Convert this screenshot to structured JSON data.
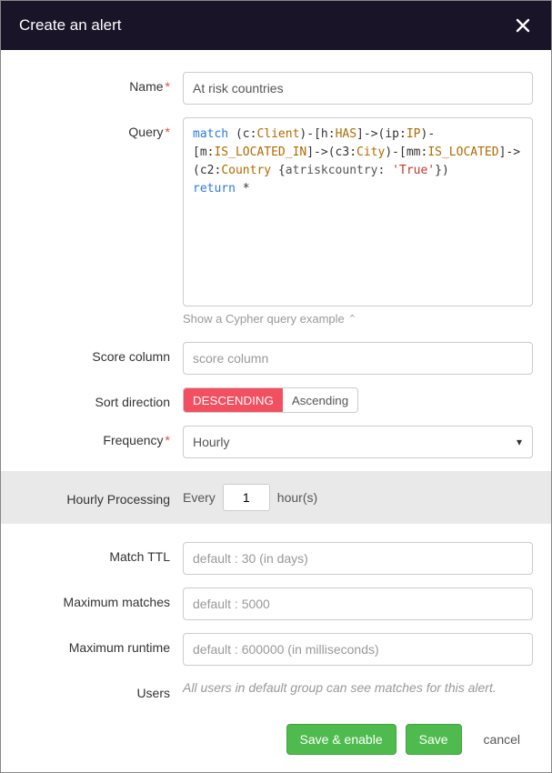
{
  "header": {
    "title": "Create an alert"
  },
  "labels": {
    "name": "Name",
    "query": "Query",
    "score_column": "Score column",
    "sort_direction": "Sort direction",
    "frequency": "Frequency",
    "hourly_processing": "Hourly Processing",
    "match_ttl": "Match TTL",
    "max_matches": "Maximum matches",
    "max_runtime": "Maximum runtime",
    "users": "Users"
  },
  "fields": {
    "name_value": "At risk countries",
    "query_tokens": [
      {
        "t": "match ",
        "c": "kw"
      },
      {
        "t": "(c:",
        "c": "rel"
      },
      {
        "t": "Client",
        "c": "lbl"
      },
      {
        "t": ")-[h:",
        "c": "rel"
      },
      {
        "t": "HAS",
        "c": "lbl"
      },
      {
        "t": "]->(ip:",
        "c": "rel"
      },
      {
        "t": "IP",
        "c": "lbl"
      },
      {
        "t": ")-[m:",
        "c": "rel"
      },
      {
        "t": "IS_LOCATED_IN",
        "c": "lbl"
      },
      {
        "t": "]->(c3:",
        "c": "rel"
      },
      {
        "t": "City",
        "c": "lbl"
      },
      {
        "t": ")-[mm:",
        "c": "rel"
      },
      {
        "t": "IS_LOCATED",
        "c": "lbl"
      },
      {
        "t": "]->(c2:",
        "c": "rel"
      },
      {
        "t": "Country",
        "c": "lbl"
      },
      {
        "t": " {",
        "c": "rel"
      },
      {
        "t": "atriskcountry",
        "c": "prop"
      },
      {
        "t": ": ",
        "c": "rel"
      },
      {
        "t": "'True'",
        "c": "str"
      },
      {
        "t": "})",
        "c": "rel"
      },
      {
        "t": "\n",
        "c": ""
      },
      {
        "t": "return ",
        "c": "kw"
      },
      {
        "t": "*",
        "c": "rel"
      }
    ],
    "example_link": "Show a Cypher query example",
    "score_column_placeholder": "score column",
    "sort_descending": "DESCENDING",
    "sort_ascending": "Ascending",
    "frequency_value": "Hourly",
    "hourly_every": "Every",
    "hourly_value": "1",
    "hourly_unit": "hour(s)",
    "match_ttl_placeholder": "default : 30 (in days)",
    "max_matches_placeholder": "default : 5000",
    "max_runtime_placeholder": "default : 600000 (in milliseconds)",
    "users_note": "All users in default group can see matches for this alert."
  },
  "footer": {
    "save_enable": "Save & enable",
    "save": "Save",
    "cancel": "cancel"
  }
}
